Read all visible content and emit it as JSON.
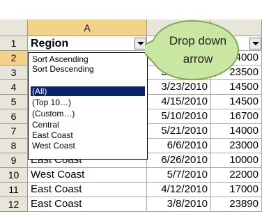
{
  "sheet": {
    "column_header": "A",
    "header_cell": "Region",
    "row_numbers": [
      "1",
      "2",
      "3",
      "4",
      "5",
      "6",
      "7",
      "8",
      "9",
      "10",
      "11",
      "12"
    ],
    "rows": [
      {
        "region": "",
        "date": "",
        "amount": "4000"
      },
      {
        "region": "",
        "date": "3/12/2010",
        "amount": "23500"
      },
      {
        "region": "",
        "date": "3/23/2010",
        "amount": "14500"
      },
      {
        "region": "",
        "date": "4/15/2010",
        "amount": "14500"
      },
      {
        "region": "",
        "date": "5/10/2010",
        "amount": "16700"
      },
      {
        "region": "",
        "date": "5/21/2010",
        "amount": "14000"
      },
      {
        "region": "",
        "date": "6/6/2010",
        "amount": "23000"
      },
      {
        "region": "East Coast",
        "date": "6/26/2010",
        "amount": "10000"
      },
      {
        "region": "West Coast",
        "date": "5/7/2010",
        "amount": "22000"
      },
      {
        "region": "East Coast",
        "date": "4/12/2010",
        "amount": "17000"
      },
      {
        "region": "East Coast",
        "date": "3/8/2010",
        "amount": "23890"
      }
    ]
  },
  "dropdown": {
    "items": [
      {
        "label": "Sort Ascending",
        "selected": false
      },
      {
        "label": "Sort Descending",
        "selected": false
      },
      {
        "label": "(All)",
        "selected": true
      },
      {
        "label": "(Top 10…)",
        "selected": false
      },
      {
        "label": "(Custom…)",
        "selected": false
      },
      {
        "label": "Central",
        "selected": false
      },
      {
        "label": "East Coast",
        "selected": false
      },
      {
        "label": "West Coast",
        "selected": false
      }
    ]
  },
  "callout": {
    "line1": "Drop down",
    "line2": "arrow",
    "fill_color": "#c9e6a3",
    "stroke_color": "#7faa55"
  },
  "colors": {
    "header_bg": "#e8e6da",
    "active_header_bg": "#f3d38a",
    "selection_bg": "#0a246a"
  }
}
